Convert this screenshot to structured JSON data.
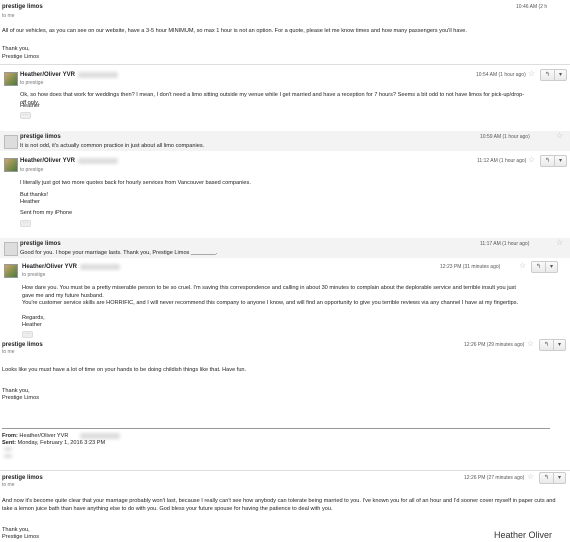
{
  "top": {
    "sender": "prestige limos",
    "to": "to me",
    "time": "10:46 AM (2 h",
    "body": "All of our vehicles, as you can see on our website, have a 3-5 hour MINIMUM, so max 1 hour is not an option.  For a quote, please let me know times and how many passengers you'll have.",
    "signoff1": "Thank you,",
    "signoff2": "Prestige Limos"
  },
  "msg1": {
    "sender": "Heather/Oliver YVR",
    "to": "to prestige",
    "time": "10:54 AM (1 hour ago)",
    "body": "Ok, so how does that work for weddings then? I mean, I don't need a limo sitting outside my venue while I get married and have a reception for 7 hours? Seems a bit odd to not have limos for pick-up/drop-off only.",
    "sign": "Heather"
  },
  "msg2": {
    "sender": "prestige limos",
    "time": "10:59 AM (1 hour ago)",
    "body": "It is not odd, it's actually common practice in just about all limo companies."
  },
  "msg3": {
    "sender": "Heather/Oliver YVR",
    "to": "to prestige",
    "time": "11:12 AM (1 hour ago)",
    "body": "I literally just got two more quotes back for hourly services from Vancouver based companies.",
    "line2": "But thanks!",
    "line3": "Heather",
    "line4": "Sent from my iPhone"
  },
  "msg4": {
    "sender": "prestige limos",
    "time": "11:17 AM (1 hour ago)",
    "body": "Good for you. I hope your marriage lasts. Thank you, Prestige Limos ________."
  },
  "msg5": {
    "sender": "Heather/Oliver YVR",
    "to": "to prestige",
    "time": "12:23 PM (31 minutes ago)",
    "body1": "How dare you. You must be a pretty miserable person to be so cruel. I'm saving this correspondence and calling in about 30 minutes to complain about the deplorable service and terrible insult you just gave me and my future husband.",
    "body2": "You're customer service skills are HORRIFIC, and I will never recommend this company to anyone I know, and will find an opportunity to give you terrible reviews via any channel I have at my fingertips.",
    "sign1": "Regards,",
    "sign2": "Heather"
  },
  "msg6": {
    "sender": "prestige limos",
    "to": "to me",
    "time": "12:26 PM (29 minutes ago)",
    "body": "Looks like you must have a lot of time on your hands to be doing childish things like that.  Have fun.",
    "signoff1": "Thank you,",
    "signoff2": "Prestige Limos",
    "quote_from_label": "From:",
    "quote_from": "Heather/Oliver YVR",
    "quote_sent_label": "Sent:",
    "quote_sent": "Monday, February 1, 2016 3:23 PM"
  },
  "msg7": {
    "sender": "prestige limos",
    "to": "to me",
    "time": "12:26 PM (27 minutes ago)",
    "body": "And now it's become quite clear that your marriage probably won't last, because I really can't see how anybody can tolerate being married to you.  I've known you for all of an hour and I'd sooner cover myself in paper cuts and take a lemon juice bath than have anything else to do with you.  God bless your future spouse for having the patience to deal with you.",
    "signoff1": "Thank you,",
    "signoff2": "Prestige Limos"
  },
  "credit": "Heather Oliver",
  "icons": {
    "reply": "reply-arrow-icon",
    "more": "chevron-down-icon",
    "star": "star-icon",
    "expand": "dots-icon"
  }
}
